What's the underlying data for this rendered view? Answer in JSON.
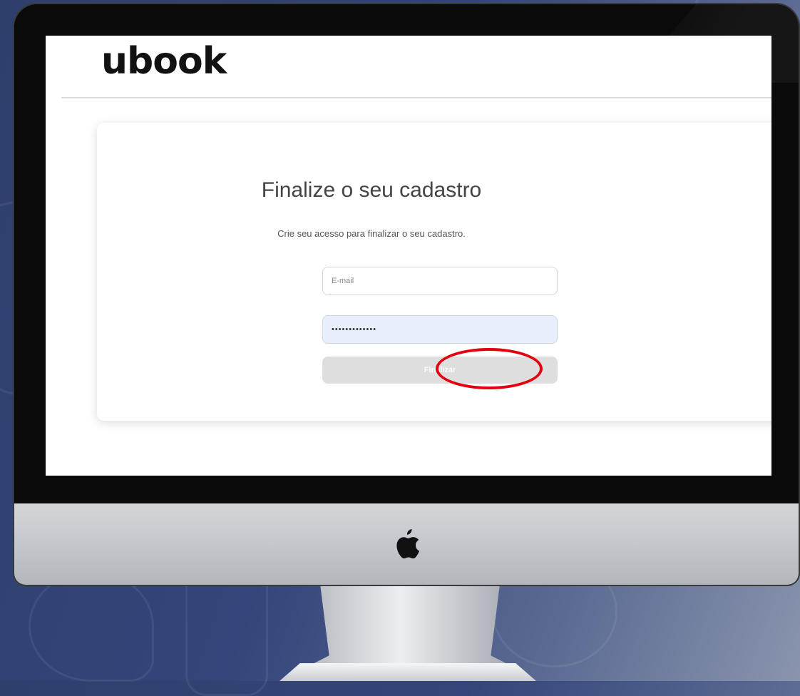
{
  "site": {
    "logo_text": "ubook"
  },
  "form": {
    "title": "Finalize o seu cadastro",
    "subtitle": "Crie seu acesso para finalizar o seu cadastro.",
    "email_placeholder": "E-mail",
    "password_value": "•••••••••••••",
    "submit_label": "Finalizar"
  },
  "annotation": {
    "highlight_color": "#e3000f",
    "highlight_target": "submit-button"
  },
  "colors": {
    "background": "#33457a",
    "button_disabled": "#dedede",
    "password_fill": "#e8eefb"
  },
  "icons": {
    "monitor_logo": "apple-icon"
  }
}
